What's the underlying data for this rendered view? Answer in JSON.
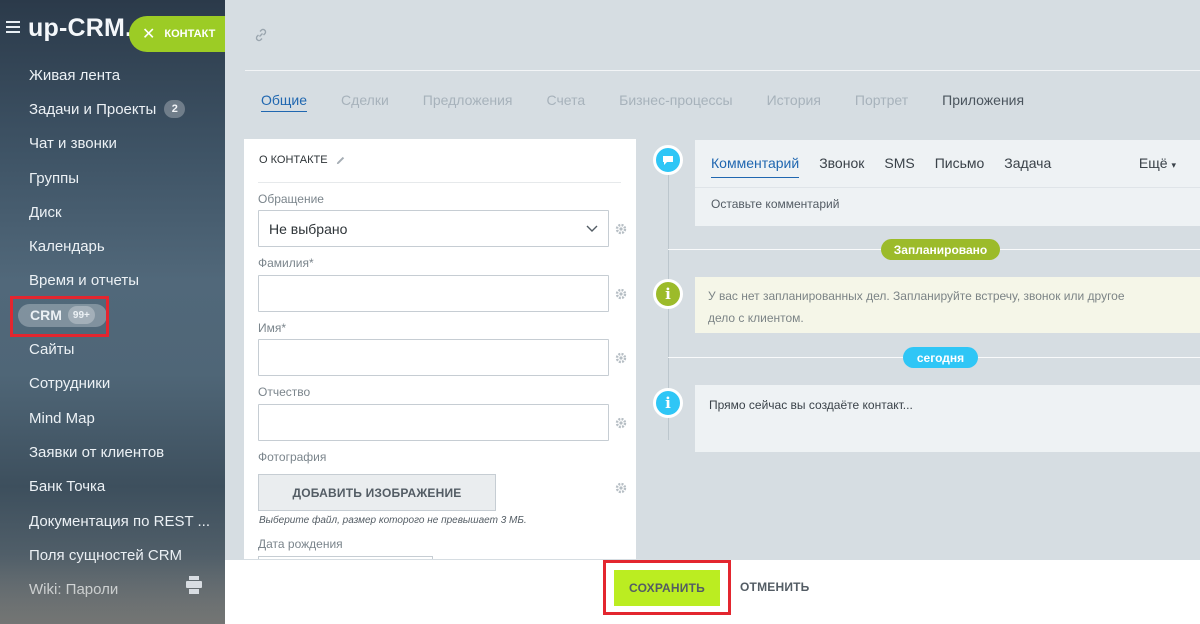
{
  "sidebar": {
    "logo": "up-CRM.r",
    "contact_badge": "КОНТАКТ",
    "items": [
      {
        "label": "Живая лента"
      },
      {
        "label": "Задачи и Проекты",
        "count": "2"
      },
      {
        "label": "Чат и звонки"
      },
      {
        "label": "Группы"
      },
      {
        "label": "Диск"
      },
      {
        "label": "Календарь"
      },
      {
        "label": "Время и отчеты"
      },
      {
        "label": "CRM",
        "count": "99+"
      },
      {
        "label": "Сайты"
      },
      {
        "label": "Сотрудники"
      },
      {
        "label": "Mind Map"
      },
      {
        "label": "Заявки от клиентов"
      },
      {
        "label": "Банк Точка"
      },
      {
        "label": "Документация по REST ..."
      },
      {
        "label": "Поля сущностей CRM"
      },
      {
        "label": "Wiki: Пароли"
      }
    ]
  },
  "tabs": [
    {
      "label": "Общие"
    },
    {
      "label": "Сделки"
    },
    {
      "label": "Предложения"
    },
    {
      "label": "Счета"
    },
    {
      "label": "Бизнес-процессы"
    },
    {
      "label": "История"
    },
    {
      "label": "Портрет"
    },
    {
      "label": "Приложения"
    }
  ],
  "form": {
    "title": "О КОНТАКТЕ",
    "fields": {
      "salutation_label": "Обращение",
      "salutation_value": "Не выбрано",
      "last_name_label": "Фамилия*",
      "first_name_label": "Имя*",
      "middle_name_label": "Отчество",
      "photo_label": "Фотография",
      "birthdate_label": "Дата рождения"
    },
    "add_image_button": "ДОБАВИТЬ ИЗОБРАЖЕНИЕ",
    "file_hint": "Выберите файл, размер которого не превышает 3 МБ."
  },
  "timeline": {
    "tabs": [
      {
        "label": "Комментарий"
      },
      {
        "label": "Звонок"
      },
      {
        "label": "SMS"
      },
      {
        "label": "Письмо"
      },
      {
        "label": "Задача"
      }
    ],
    "more": "Ещё",
    "comment_placeholder": "Оставьте комментарий",
    "planned_badge": "Запланировано",
    "planned_notice": "У вас нет запланированных дел. Запланируйте встречу, звонок или другое дело с клиентом.",
    "today_badge": "сегодня",
    "creating_text": "Прямо сейчас вы создаёте контакт..."
  },
  "footer": {
    "save": "СОХРАНИТЬ",
    "cancel": "ОТМЕНИТЬ"
  },
  "colors": {
    "accent_blue": "#2067b0",
    "save_green": "#bbed21",
    "badge_green": "#9cbb2a",
    "badge_blue": "#2fc6f6",
    "highlight_red": "#e3262f"
  }
}
